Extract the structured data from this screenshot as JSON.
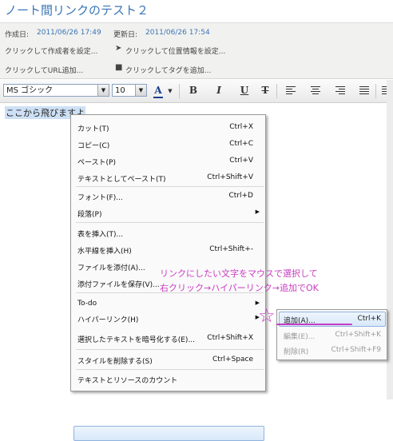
{
  "page": {
    "title": "ノート間リンクのテスト２"
  },
  "meta": {
    "created_label": "作成日:",
    "created_value": "2011/06/26 17:49",
    "updated_label": "更新日:",
    "updated_value": "2011/06/26 17:54",
    "author_placeholder": "クリックして作成者を設定...",
    "location_placeholder": "クリックして位置情報を設定...",
    "url_placeholder": "クリックしてURL追加...",
    "tag_placeholder": "クリックしてタグを追加..."
  },
  "toolbar": {
    "font_name": "MS ゴシック",
    "font_size": "10",
    "font_color_label": "A",
    "bold": "B",
    "italic": "I",
    "underline": "U",
    "strike": "T"
  },
  "editor": {
    "selected_text": "ここから飛びますよ"
  },
  "context_menu": {
    "items": [
      {
        "label": "カット(T)",
        "shortcut": "Ctrl+X"
      },
      {
        "label": "コピー(C)",
        "shortcut": "Ctrl+C"
      },
      {
        "label": "ペースト(P)",
        "shortcut": "Ctrl+V"
      },
      {
        "label": "テキストとしてペースト(T)",
        "shortcut": "Ctrl+Shift+V"
      },
      {
        "label": "フォント(F)...",
        "shortcut": "Ctrl+D"
      },
      {
        "label": "段落(P)",
        "shortcut": ""
      },
      {
        "label": "表を挿入(T)...",
        "shortcut": ""
      },
      {
        "label": "水平線を挿入(H)",
        "shortcut": "Ctrl+Shift+-"
      },
      {
        "label": "ファイルを添付(A)...",
        "shortcut": ""
      },
      {
        "label": "添付ファイルを保存(V)...",
        "shortcut": ""
      },
      {
        "label": "To-do",
        "shortcut": ""
      },
      {
        "label": "ハイパーリンク(H)",
        "shortcut": ""
      },
      {
        "label": "選択したテキストを暗号化する(E)...",
        "shortcut": "Ctrl+Shift+X"
      },
      {
        "label": "スタイルを削除する(S)",
        "shortcut": "Ctrl+Space"
      },
      {
        "label": "テキストとリソースのカウント",
        "shortcut": ""
      }
    ]
  },
  "submenu": {
    "items": [
      {
        "label": "追加(A)...",
        "shortcut": "Ctrl+K",
        "enabled": true
      },
      {
        "label": "編集(E)...",
        "shortcut": "Ctrl+Shift+K",
        "enabled": false
      },
      {
        "label": "削除(R)",
        "shortcut": "Ctrl+Shift+F9",
        "enabled": false
      }
    ]
  },
  "annotation": {
    "line1": "リンクにしたい文字をマウスで選択して",
    "line2": "右クリック→ハイパーリンク→追加でOK",
    "color": "#c83cc0"
  },
  "colors": {
    "accent": "#3a76b8",
    "highlight": "#d8e8fa"
  }
}
